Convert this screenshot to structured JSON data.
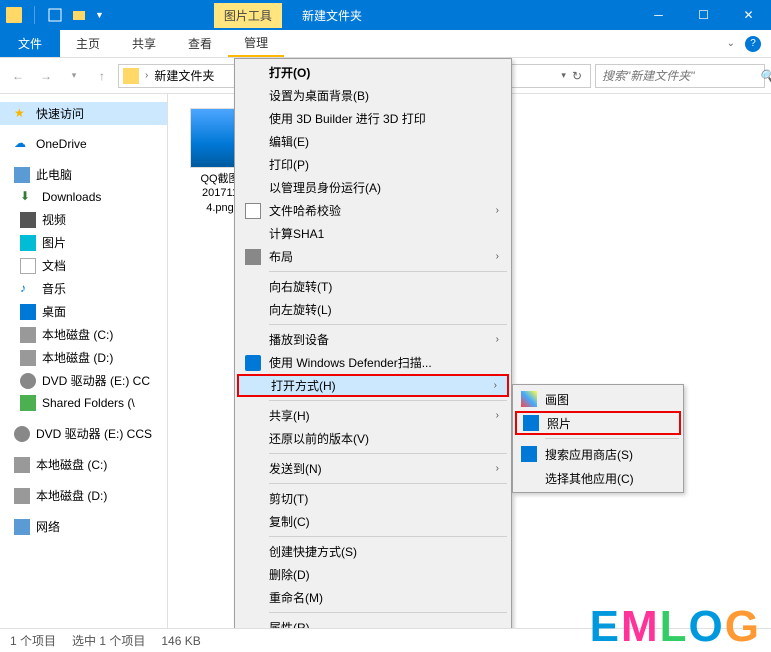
{
  "titlebar": {
    "picture_tools": "图片工具",
    "window_title": "新建文件夹"
  },
  "ribbon": {
    "file": "文件",
    "home": "主页",
    "share": "共享",
    "view": "查看",
    "manage": "管理"
  },
  "breadcrumb": {
    "current": "新建文件夹"
  },
  "search": {
    "placeholder": "搜索\"新建文件夹\""
  },
  "sidebar": {
    "quick_access": "快速访问",
    "onedrive": "OneDrive",
    "this_pc": "此电脑",
    "downloads": "Downloads",
    "videos": "视频",
    "pictures": "图片",
    "documents": "文档",
    "music": "音乐",
    "desktop": "桌面",
    "disk_c": "本地磁盘 (C:)",
    "disk_d": "本地磁盘 (D:)",
    "dvd_e1": "DVD 驱动器 (E:) CC",
    "shared": "Shared Folders (\\",
    "dvd_e2": "DVD 驱动器 (E:) CCS",
    "disk_c2": "本地磁盘 (C:)",
    "disk_d2": "本地磁盘 (D:)",
    "network": "网络"
  },
  "file": {
    "name_l1": "QQ截图",
    "name_l2": "201711",
    "name_l3": "4.png"
  },
  "context_menu": {
    "open": "打开(O)",
    "set_bg": "设置为桌面背景(B)",
    "builder3d": "使用 3D Builder 进行 3D 打印",
    "edit": "编辑(E)",
    "print": "打印(P)",
    "run_admin": "以管理员身份运行(A)",
    "hash": "文件哈希校验",
    "sha1": "计算SHA1",
    "layout": "布局",
    "rotate_r": "向右旋转(T)",
    "rotate_l": "向左旋转(L)",
    "cast": "播放到设备",
    "defender": "使用 Windows Defender扫描...",
    "open_with": "打开方式(H)",
    "share": "共享(H)",
    "versions": "还原以前的版本(V)",
    "send_to": "发送到(N)",
    "cut": "剪切(T)",
    "copy": "复制(C)",
    "shortcut": "创建快捷方式(S)",
    "delete": "删除(D)",
    "rename": "重命名(M)",
    "properties": "属性(R)"
  },
  "submenu": {
    "paint": "画图",
    "photos": "照片",
    "store": "搜索应用商店(S)",
    "choose": "选择其他应用(C)"
  },
  "statusbar": {
    "items": "1 个项目",
    "selected": "选中 1 个项目",
    "size": "146 KB"
  },
  "watermark": "EMLOG"
}
